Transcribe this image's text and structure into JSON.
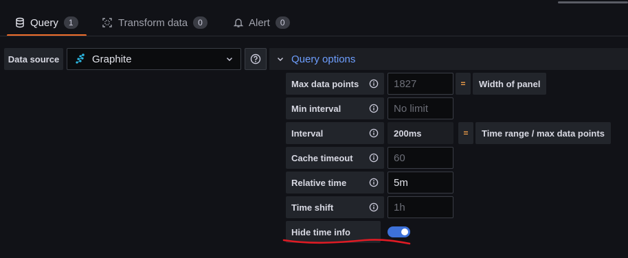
{
  "tabs": [
    {
      "label": "Query",
      "count": "1",
      "icon": "database-icon",
      "active": true
    },
    {
      "label": "Transform data",
      "count": "0",
      "icon": "transform-icon",
      "active": false
    },
    {
      "label": "Alert",
      "count": "0",
      "icon": "bell-icon",
      "active": false
    }
  ],
  "datasource": {
    "label": "Data source",
    "selected": "Graphite",
    "icon": "graphite-icon"
  },
  "query_options": {
    "title": "Query options",
    "rows": [
      {
        "label": "Max data points",
        "value": "1827",
        "is_placeholder": true,
        "equals": "=",
        "note": "Width of panel"
      },
      {
        "label": "Min interval",
        "value": "No limit",
        "is_placeholder": true
      },
      {
        "label": "Interval",
        "value": "200ms",
        "is_placeholder": false,
        "equals": "=",
        "note": "Time range / max data points"
      },
      {
        "label": "Cache timeout",
        "value": "60",
        "is_placeholder": true
      },
      {
        "label": "Relative time",
        "value": "5m",
        "is_placeholder": false
      },
      {
        "label": "Time shift",
        "value": "1h",
        "is_placeholder": true
      }
    ],
    "hide_time_info": {
      "label": "Hide time info",
      "enabled": true
    }
  },
  "colors": {
    "background": "#111217",
    "accent_tab": "#f06e2b",
    "link": "#6e9fff",
    "toggle_on": "#3d71d9",
    "annotation": "#e01b24"
  }
}
